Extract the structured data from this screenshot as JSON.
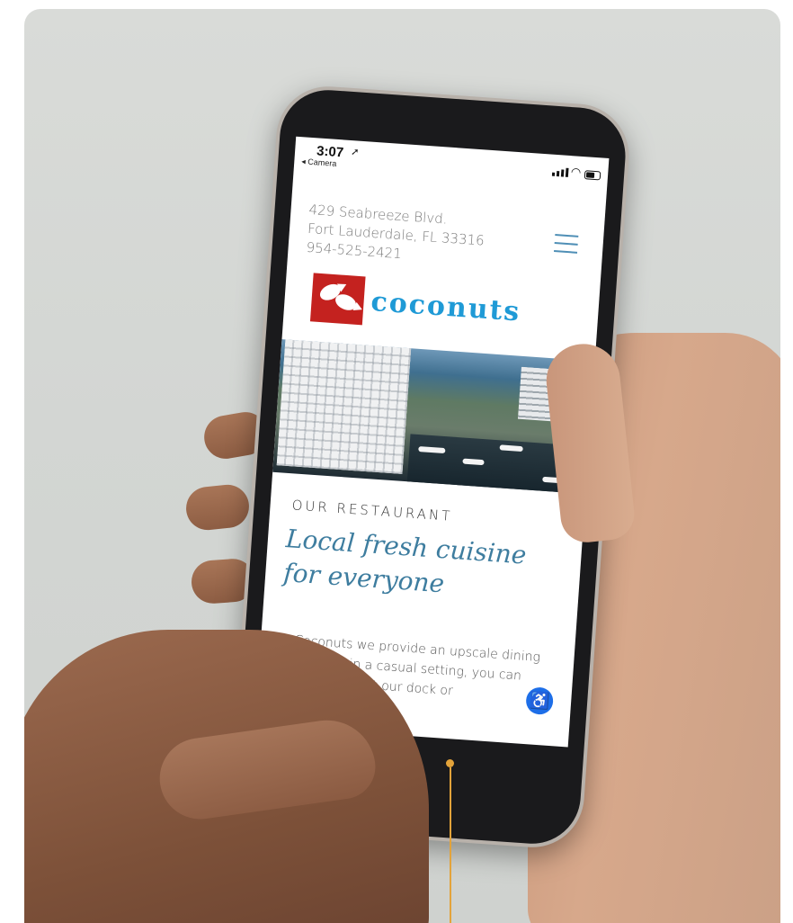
{
  "status_bar": {
    "time": "3:07",
    "back_label": "◂ Camera"
  },
  "site": {
    "address_line1": "429 Seabreeze Blvd.",
    "address_line2": "Fort Lauderdale, FL 33316",
    "phone": "954-525-2421",
    "logo_text": "coconuts",
    "eyebrow": "OUR RESTAURANT",
    "headline_line1": "Local fresh cuisine",
    "headline_line2": "for everyone",
    "body": "At Coconuts we provide an upscale dining experience in a casual setting, you can raft your boat at our dock or"
  },
  "colors": {
    "accent_blue": "#3e7d9f",
    "logo_red": "#c4221f",
    "logo_blue": "#1f9ad6",
    "pointer": "#e3a33a"
  },
  "icons": {
    "menu": "hamburger-menu-icon",
    "accessibility": "accessibility-icon"
  }
}
